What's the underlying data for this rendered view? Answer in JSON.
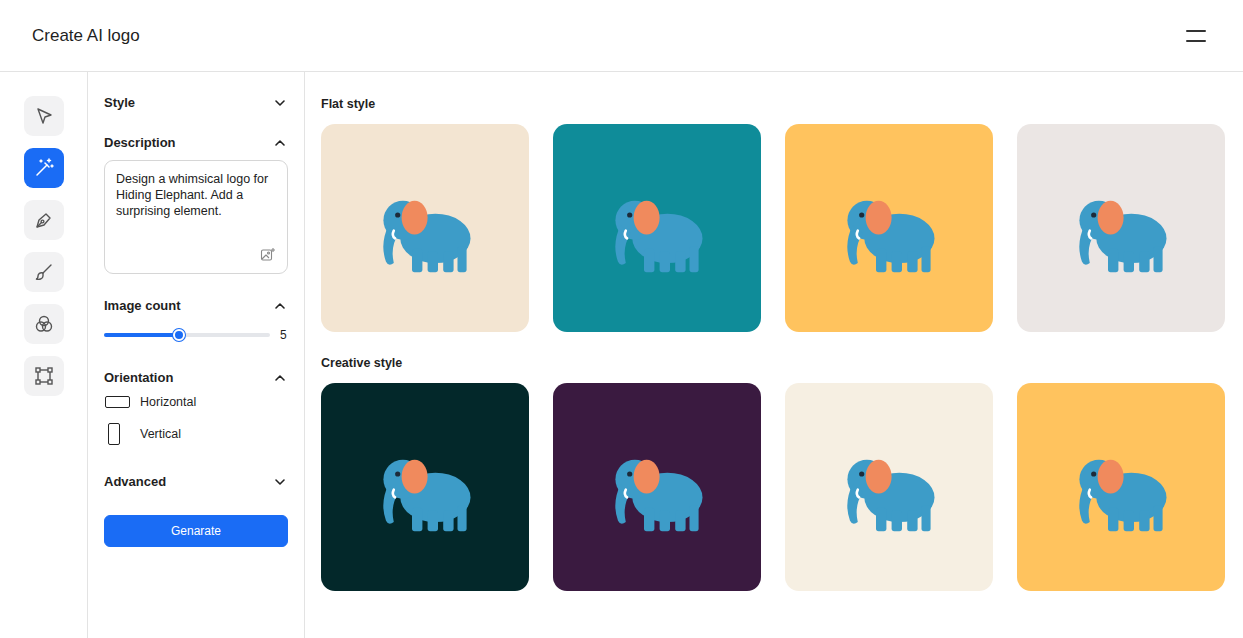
{
  "header": {
    "title": "Create AI logo"
  },
  "tool_rail": {
    "items": [
      {
        "kind": "select",
        "selected": false
      },
      {
        "kind": "generate",
        "selected": true
      },
      {
        "kind": "pen",
        "selected": false
      },
      {
        "kind": "brush",
        "selected": false
      },
      {
        "kind": "shapes",
        "selected": false
      },
      {
        "kind": "frame",
        "selected": false
      }
    ]
  },
  "settings": {
    "style": {
      "label": "Style",
      "expanded": false
    },
    "description": {
      "label": "Description",
      "expanded": true,
      "value": "Design a whimsical logo for Hiding Elephant. Add a surprising element."
    },
    "image_count": {
      "label": "Image count",
      "expanded": true,
      "value": "5",
      "level": 0.45
    },
    "orientation": {
      "label": "Orientation",
      "expanded": true,
      "options": [
        {
          "label": "Horizontal",
          "kind": "horizontal"
        },
        {
          "label": "Vertical",
          "kind": "vertical"
        }
      ]
    },
    "advanced": {
      "label": "Advanced",
      "expanded": false
    },
    "generate_button": "Genarate"
  },
  "gallery": {
    "groups": [
      {
        "title": "Flat style",
        "images": [
          {
            "color": "#f3e5d2"
          },
          {
            "color": "#0f8c99"
          },
          {
            "color": "#ffc35e"
          },
          {
            "color": "#ebe6e4"
          }
        ]
      },
      {
        "title": "Creative style",
        "images": [
          {
            "color": "#03282a"
          },
          {
            "color": "#3a1a40"
          },
          {
            "color": "#f6efe2"
          },
          {
            "color": "#ffc35e"
          }
        ]
      }
    ]
  }
}
